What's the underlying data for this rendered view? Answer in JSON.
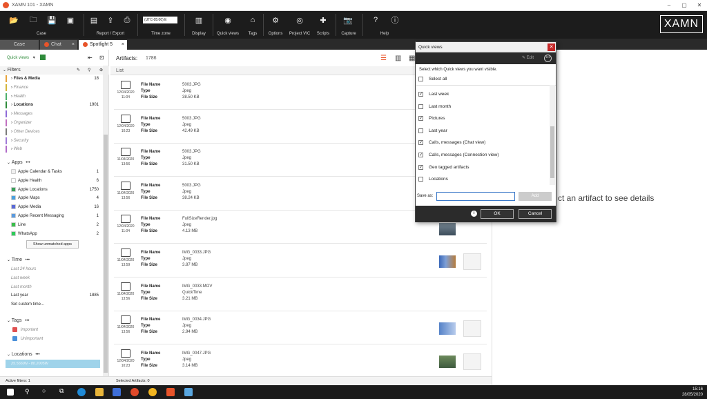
{
  "window": {
    "title": "XAMN 101 - XAMN"
  },
  "ribbon": {
    "groups": [
      {
        "label": "Case"
      },
      {
        "label": "Report / Export"
      },
      {
        "label": "Time zone"
      },
      {
        "label": "Display"
      },
      {
        "label": "Quick views"
      },
      {
        "label": "Tags"
      },
      {
        "label": "Options"
      },
      {
        "label": "Project VIC"
      },
      {
        "label": "Scripts"
      },
      {
        "label": "Capture"
      },
      {
        "label": "Help"
      }
    ],
    "timezone_value": "(UTC-05:00) E",
    "brand": "XAMN"
  },
  "tabs": [
    {
      "label": "Case"
    },
    {
      "label": "Chat"
    },
    {
      "label": "Spotlight 5"
    }
  ],
  "left": {
    "quick_views": "Quick views",
    "filters": "Filters",
    "categories": [
      {
        "label": "Files & Media",
        "count": "18"
      },
      {
        "label": "Finance",
        "count": ""
      },
      {
        "label": "Health",
        "count": ""
      },
      {
        "label": "Locations",
        "count": "1901"
      },
      {
        "label": "Messages",
        "count": ""
      },
      {
        "label": "Organizer",
        "count": ""
      },
      {
        "label": "Other Devices",
        "count": ""
      },
      {
        "label": "Security",
        "count": ""
      },
      {
        "label": "Web",
        "count": ""
      }
    ],
    "apps_title": "Apps",
    "apps": [
      {
        "label": "Apple Calendar & Tasks",
        "count": "1"
      },
      {
        "label": "Apple Health",
        "count": "6"
      },
      {
        "label": "Apple Locations",
        "count": "1750"
      },
      {
        "label": "Apple Maps",
        "count": "4"
      },
      {
        "label": "Apple Media",
        "count": "16"
      },
      {
        "label": "Apple Recent Messaging",
        "count": "1"
      },
      {
        "label": "Line",
        "count": "2"
      },
      {
        "label": "WhatsApp",
        "count": "2"
      }
    ],
    "show_unmatched": "Show unmatched apps",
    "time_title": "Time",
    "time": [
      {
        "label": "Last 24 hours",
        "count": ""
      },
      {
        "label": "Last week",
        "count": ""
      },
      {
        "label": "Last month",
        "count": ""
      },
      {
        "label": "Last year",
        "count": "1885"
      },
      {
        "label": "Set custom time...",
        "count": ""
      }
    ],
    "tags_title": "Tags",
    "tags": [
      {
        "label": "Important"
      },
      {
        "label": "Unimportant"
      }
    ],
    "locations_title": "Locations",
    "locations_item": "25.5669N - 80.2005W"
  },
  "center": {
    "artifacts_label": "Artifacts:",
    "artifacts_count": "1786",
    "list_label": "List",
    "field_labels": {
      "name": "File Name",
      "type": "Type",
      "size": "File Size"
    },
    "rows": [
      {
        "date": "12/04/2020",
        "time": "11:04",
        "name": "5003.JPG",
        "type": "Jpeg",
        "size": "38.50 KB"
      },
      {
        "date": "12/04/2020",
        "time": "10:23",
        "name": "5003.JPG",
        "type": "Jpeg",
        "size": "42.49 KB"
      },
      {
        "date": "11/04/2020",
        "time": "13:56",
        "name": "5003.JPG",
        "type": "Jpeg",
        "size": "31.50 KB"
      },
      {
        "date": "11/04/2020",
        "time": "13:56",
        "name": "5003.JPG",
        "type": "Jpeg",
        "size": "38.24 KB"
      },
      {
        "date": "12/04/2020",
        "time": "11:04",
        "name": "FullSizeRender.jpg",
        "type": "Jpeg",
        "size": "4.13 MB"
      },
      {
        "date": "11/04/2020",
        "time": "13:59",
        "name": "IMG_0033.JPG",
        "type": "Jpeg",
        "size": "3.87 MB"
      },
      {
        "date": "11/04/2020",
        "time": "13:56",
        "name": "IMG_0033.MOV",
        "type": "QuickTime",
        "size": "3.21 MB"
      },
      {
        "date": "11/04/2020",
        "time": "13:56",
        "name": "IMG_0034.JPG",
        "type": "Jpeg",
        "size": "2.94 MB"
      },
      {
        "date": "12/04/2020",
        "time": "10:23",
        "name": "IMG_0047.JPG",
        "type": "Jpeg",
        "size": "3.14 MB"
      }
    ]
  },
  "detail": {
    "message": "ct an artifact to see details"
  },
  "status": {
    "active_filters": "Active filters: 1",
    "selected": "Selected Artifacts: 0"
  },
  "dialog": {
    "title": "Quick views",
    "edit": "Edit",
    "instruction": "Select which Quick views you want visible.",
    "select_all": "Select all",
    "items": [
      {
        "label": "Last week",
        "checked": true
      },
      {
        "label": "Last month",
        "checked": false
      },
      {
        "label": "Pictures",
        "checked": true
      },
      {
        "label": "Last year",
        "checked": false
      },
      {
        "label": "Calls, messages (Chat view)",
        "checked": true
      },
      {
        "label": "Calls, messages (Connection view)",
        "checked": true
      },
      {
        "label": "Geo tagged artifacts",
        "checked": true
      },
      {
        "label": "Locations",
        "checked": false
      }
    ],
    "save_as_label": "Save as:",
    "save_as_value": "",
    "add": "Add",
    "ok": "OK",
    "cancel": "Cancel"
  },
  "clock": {
    "time": "15:16",
    "date": "28/05/2020"
  }
}
